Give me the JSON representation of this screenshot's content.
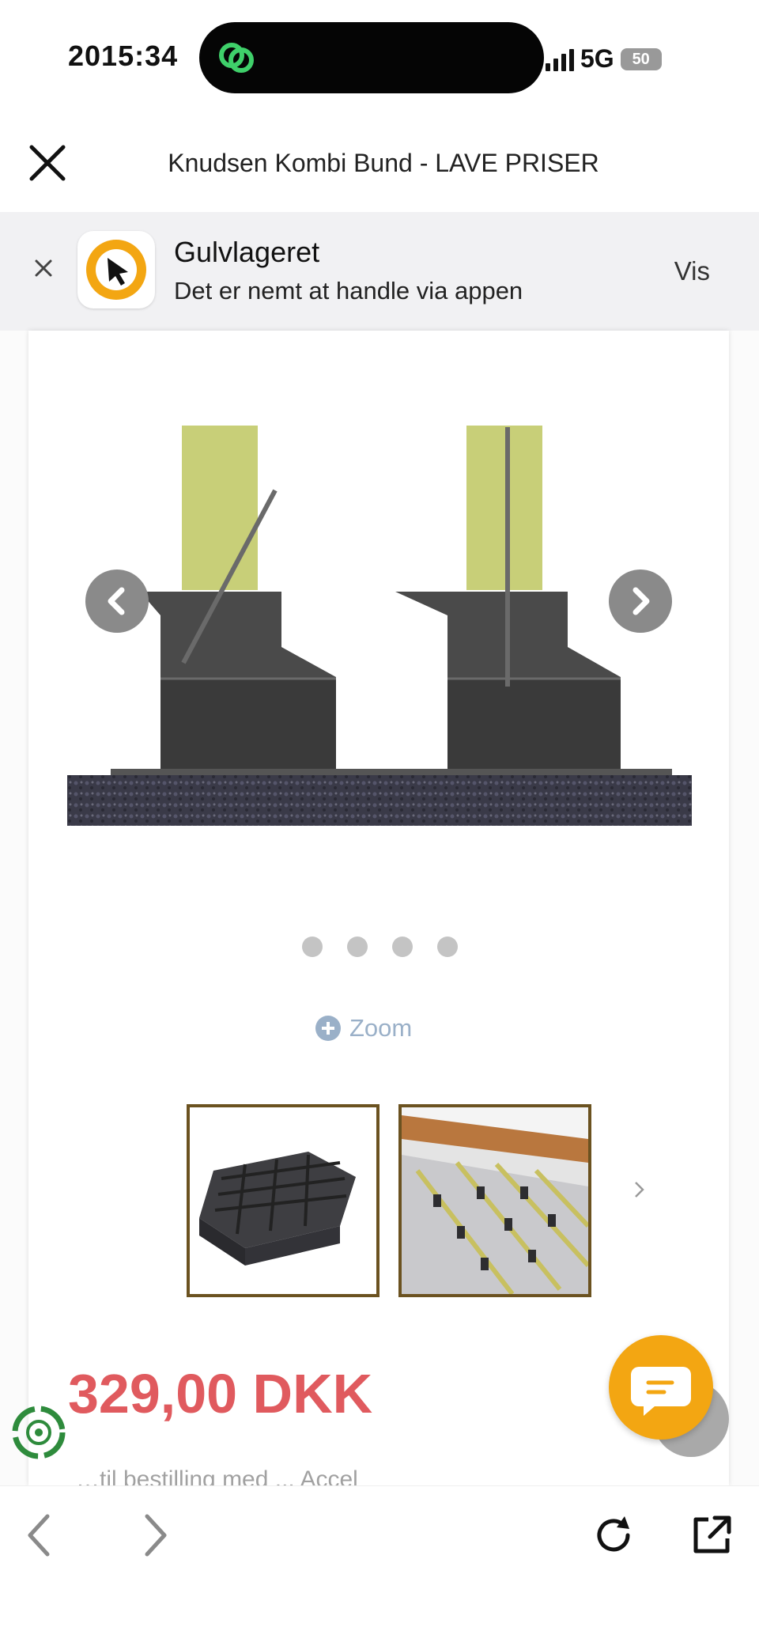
{
  "status": {
    "time": "2015:34",
    "network": "5G",
    "battery": "50"
  },
  "header": {
    "title": "Knudsen Kombi Bund - LAVE PRISER"
  },
  "banner": {
    "app_name": "Gulvlageret",
    "subtitle": "Det er nemt at handle via appen",
    "action": "Vis"
  },
  "product": {
    "zoom_label": "Zoom",
    "price": "329,00 DKK",
    "faded_text": "…til bestilling med ... Accel",
    "gallery_dots": 4
  },
  "colors": {
    "price": "#e05a5e",
    "accent": "#f3a612",
    "thumb_border": "#6b5220"
  },
  "icons": [
    "close-icon",
    "app-icon",
    "chevron-left-icon",
    "chevron-right-icon",
    "zoom-plus-icon",
    "chat-icon",
    "reload-icon",
    "share-icon"
  ]
}
